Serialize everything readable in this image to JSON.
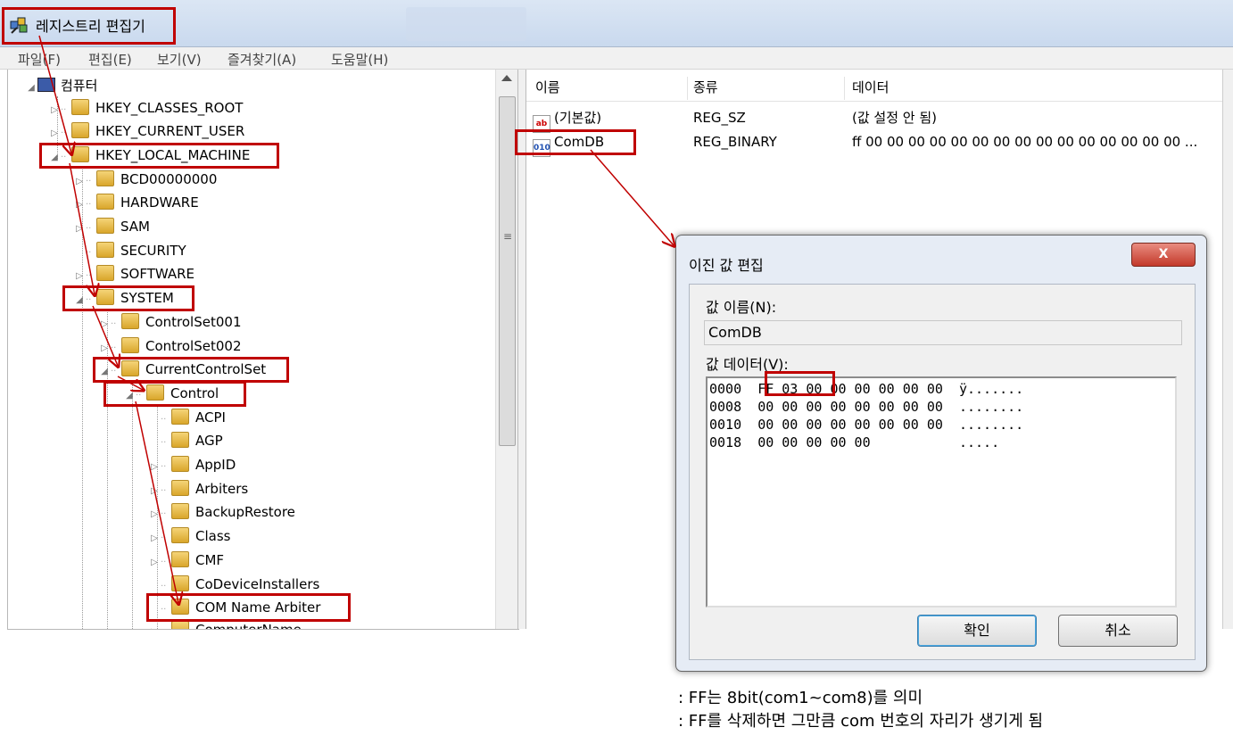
{
  "window": {
    "title": "레지스트리 편집기",
    "icon": "regedit-icon"
  },
  "menu": [
    "파일(F)",
    "편집(E)",
    "보기(V)",
    "즐겨찾기(A)",
    "도움말(H)"
  ],
  "tree": {
    "root": "컴퓨터",
    "nodes": [
      {
        "label": "HKEY_CLASSES_ROOT",
        "expander": "▷"
      },
      {
        "label": "HKEY_CURRENT_USER",
        "expander": "▷"
      },
      {
        "label": "HKEY_LOCAL_MACHINE",
        "expander": "◢"
      },
      {
        "label": "BCD00000000",
        "expander": "▷"
      },
      {
        "label": "HARDWARE",
        "expander": "▷"
      },
      {
        "label": "SAM",
        "expander": "▷"
      },
      {
        "label": "SECURITY",
        "expander": ""
      },
      {
        "label": "SOFTWARE",
        "expander": "▷"
      },
      {
        "label": "SYSTEM",
        "expander": "◢"
      },
      {
        "label": "ControlSet001",
        "expander": "▷"
      },
      {
        "label": "ControlSet002",
        "expander": "▷"
      },
      {
        "label": "CurrentControlSet",
        "expander": "◢"
      },
      {
        "label": "Control",
        "expander": "◢"
      },
      {
        "label": "ACPI",
        "expander": ""
      },
      {
        "label": "AGP",
        "expander": ""
      },
      {
        "label": "AppID",
        "expander": "▷"
      },
      {
        "label": "Arbiters",
        "expander": "▷"
      },
      {
        "label": "BackupRestore",
        "expander": "▷"
      },
      {
        "label": "Class",
        "expander": "▷"
      },
      {
        "label": "CMF",
        "expander": "▷"
      },
      {
        "label": "CoDeviceInstallers",
        "expander": ""
      },
      {
        "label": "COM Name Arbiter",
        "expander": ""
      },
      {
        "label": "ComputerName",
        "expander": "▷"
      }
    ]
  },
  "list": {
    "headers": [
      "이름",
      "종류",
      "데이터"
    ],
    "rows": [
      {
        "icon": "string-value-icon",
        "icon_text": "ab",
        "name": "(기본값)",
        "type": "REG_SZ",
        "data": "(값 설정 안 됨)"
      },
      {
        "icon": "binary-value-icon",
        "icon_text": "010",
        "name": "ComDB",
        "type": "REG_BINARY",
        "data": "ff 00 00 00 00 00 00 00 00 00 00 00 00 00 00 00 ..."
      }
    ]
  },
  "dialog": {
    "title": "이진 값 편집",
    "close_label": "X",
    "value_name_label": "값 이름(N):",
    "value_name": "ComDB",
    "value_data_label": "값 데이터(V):",
    "hex_rows": [
      {
        "offset": "0000",
        "bytes": "FF 03 00 00 00 00 00 00",
        "ascii": "ÿ......."
      },
      {
        "offset": "0008",
        "bytes": "00 00 00 00 00 00 00 00",
        "ascii": "........"
      },
      {
        "offset": "0010",
        "bytes": "00 00 00 00 00 00 00 00",
        "ascii": "........"
      },
      {
        "offset": "0018",
        "bytes": "00 00 00 00 00",
        "ascii": "....."
      }
    ],
    "ok_label": "확인",
    "cancel_label": "취소"
  },
  "notes": [
    ": FF는 8bit(com1~com8)를 의미",
    ": FF를 삭제하면 그만큼 com 번호의 자리가 생기게 됨"
  ],
  "colors": {
    "highlight": "#c00000",
    "titlebar": "#dbe6f4",
    "folder": "#f5d478"
  }
}
